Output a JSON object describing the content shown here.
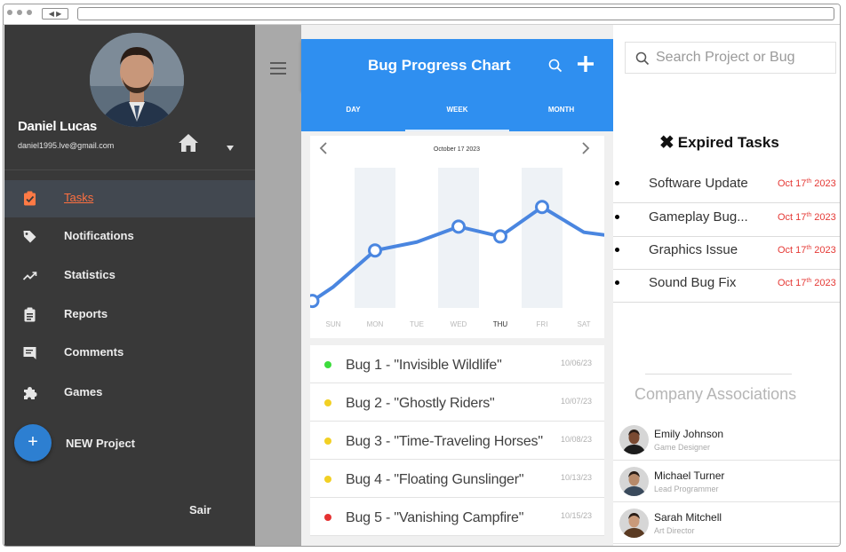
{
  "user": {
    "name": "Daniel Lucas",
    "email": "daniel1995.lve@gmail.com"
  },
  "menu": [
    {
      "label": "Tasks",
      "icon": "clipboard-check-icon",
      "active": true
    },
    {
      "label": "Notifications",
      "icon": "tag-icon",
      "active": false
    },
    {
      "label": "Statistics",
      "icon": "trending-icon",
      "active": false
    },
    {
      "label": "Reports",
      "icon": "clipboard-icon",
      "active": false
    },
    {
      "label": "Comments",
      "icon": "comment-icon",
      "active": false
    },
    {
      "label": "Games",
      "icon": "puzzle-icon",
      "active": false
    }
  ],
  "actions": {
    "fab_symbol": "+",
    "new_project": "NEW Project",
    "logout": "Sair"
  },
  "chart_header": {
    "title": "Bug Progress Chart"
  },
  "period_tabs": [
    "DAY",
    "WEEK",
    "MONTH"
  ],
  "active_period": "WEEK",
  "chart_data": {
    "type": "line",
    "title": "",
    "date_label": "October 17 2023",
    "categories": [
      "SUN",
      "MON",
      "TUE",
      "WED",
      "THU",
      "FRI",
      "SAT"
    ],
    "highlight_category": "THU",
    "x": [
      -0.5,
      0,
      1,
      2,
      3,
      4,
      5,
      6,
      6.5
    ],
    "values": [
      0.5,
      1.5,
      4.1,
      4.7,
      5.8,
      5.1,
      7.2,
      5.4,
      5.2
    ],
    "markers": [
      0,
      2,
      4,
      5,
      6
    ],
    "ylim": [
      0,
      10
    ],
    "grid": false,
    "colors": {
      "line": "#4a86e0",
      "column": "#eef2f6"
    }
  },
  "bugs": [
    {
      "name": "Bug 1 - \"Invisible Wildlife\"",
      "date": "10/06/23",
      "color": "#3ddc3d"
    },
    {
      "name": "Bug 2 - \"Ghostly Riders\"",
      "date": "10/07/23",
      "color": "#f2d024"
    },
    {
      "name": "Bug 3 - \"Time-Traveling Horses\"",
      "date": "10/08/23",
      "color": "#f2d024"
    },
    {
      "name": "Bug 4 - \"Floating Gunslinger\"",
      "date": "10/13/23",
      "color": "#f2d024"
    },
    {
      "name": "Bug 5 - \"Vanishing Campfire\"",
      "date": "10/15/23",
      "color": "#e53232"
    }
  ],
  "search": {
    "placeholder": "Search Project or Bug"
  },
  "expired": {
    "title": "Expired Tasks",
    "tasks": [
      {
        "name": "Software Update",
        "date_prefix": "Oct 17",
        "date_sup": "th",
        "date_suffix": " 2023"
      },
      {
        "name": "Gameplay Bug...",
        "date_prefix": "Oct 17",
        "date_sup": "th",
        "date_suffix": " 2023"
      },
      {
        "name": "Graphics Issue",
        "date_prefix": "Oct 17",
        "date_sup": "th",
        "date_suffix": " 2023"
      },
      {
        "name": "Sound Bug Fix",
        "date_prefix": "Oct 17",
        "date_sup": "th",
        "date_suffix": " 2023"
      }
    ]
  },
  "associations": {
    "title": "Company Associations",
    "people": [
      {
        "name": "Emily Johnson",
        "role": "Game Designer"
      },
      {
        "name": "Michael Turner",
        "role": "Lead Programmer"
      },
      {
        "name": "Sarah Mitchell",
        "role": "Art Director"
      }
    ]
  }
}
